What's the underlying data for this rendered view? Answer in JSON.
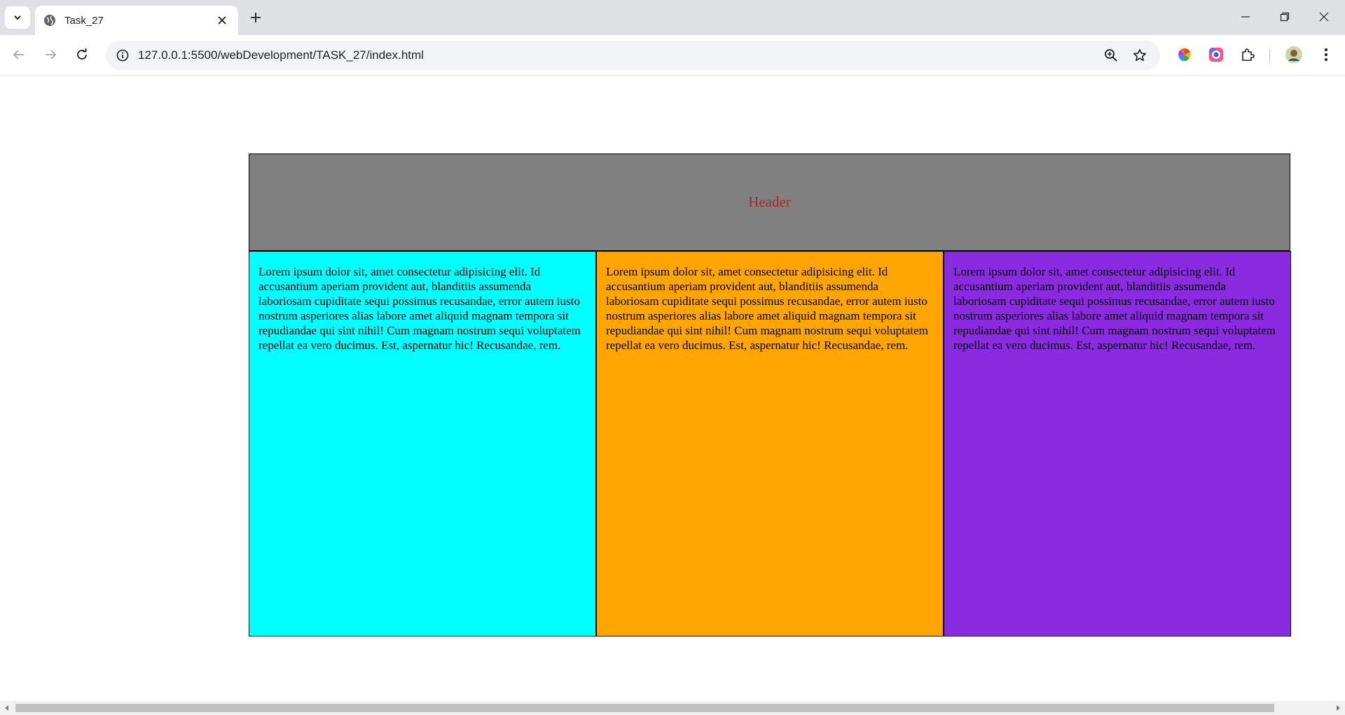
{
  "browser": {
    "tab": {
      "title": "Task_27"
    },
    "address_bar": {
      "url": "127.0.0.1:5500/webDevelopment/TASK_27/index.html"
    },
    "icons": {
      "tab_search": "chevron-down-icon",
      "favicon": "globe-icon",
      "tab_close": "close-icon",
      "new_tab": "plus-icon",
      "minimize": "minimize-icon",
      "restore": "restore-icon",
      "close_window": "close-icon",
      "back": "back-arrow-icon",
      "forward": "forward-arrow-icon",
      "reload": "reload-icon",
      "site_info": "info-icon",
      "zoom": "zoom-icon",
      "bookmark": "star-icon",
      "extension_color": "color-wheel-icon",
      "extension_screen": "screen-recorder-icon",
      "extensions": "puzzle-icon",
      "profile": "avatar",
      "menu": "kebab-menu-icon"
    }
  },
  "page": {
    "header": {
      "text": "Header",
      "background": "#808080",
      "color": "#a52a2a"
    },
    "columns": [
      {
        "background": "#00ffff",
        "text": "Lorem ipsum dolor sit, amet consectetur adipisicing elit. Id accusantium aperiam provident aut, blanditiis assumenda laboriosam cupiditate sequi possimus recusandae, error autem iusto nostrum asperiores alias labore amet aliquid magnam tempora sit repudiandae qui sint nihil! Cum magnam nostrum sequi voluptatem repellat ea vero ducimus. Est, aspernatur hic! Recusandae, rem."
      },
      {
        "background": "#ffa500",
        "text": "Lorem ipsum dolor sit, amet consectetur adipisicing elit. Id accusantium aperiam provident aut, blanditiis assumenda laboriosam cupiditate sequi possimus recusandae, error autem iusto nostrum asperiores alias labore amet aliquid magnam tempora sit repudiandae qui sint nihil! Cum magnam nostrum sequi voluptatem repellat ea vero ducimus. Est, aspernatur hic! Recusandae, rem."
      },
      {
        "background": "#8a2be2",
        "text": "Lorem ipsum dolor sit, amet consectetur adipisicing elit. Id accusantium aperiam provident aut, blanditiis assumenda laboriosam cupiditate sequi possimus recusandae, error autem iusto nostrum asperiores alias labore amet aliquid magnam tempora sit repudiandae qui sint nihil! Cum magnam nostrum sequi voluptatem repellat ea vero ducimus. Est, aspernatur hic! Recusandae, rem."
      }
    ]
  }
}
